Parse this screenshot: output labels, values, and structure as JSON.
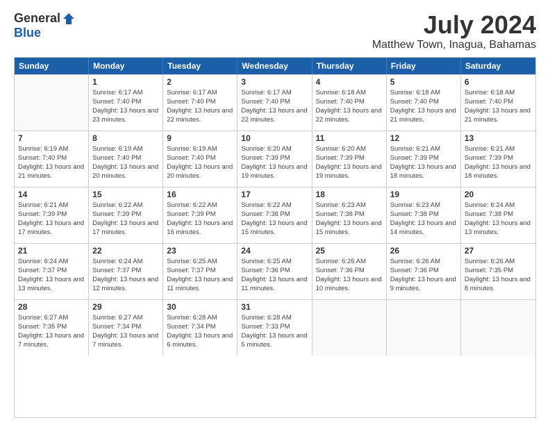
{
  "logo": {
    "general": "General",
    "blue": "Blue"
  },
  "title": {
    "month": "July 2024",
    "location": "Matthew Town, Inagua, Bahamas"
  },
  "calendar": {
    "headers": [
      "Sunday",
      "Monday",
      "Tuesday",
      "Wednesday",
      "Thursday",
      "Friday",
      "Saturday"
    ],
    "rows": [
      [
        {
          "day": "",
          "empty": true
        },
        {
          "day": "1",
          "sunrise": "6:17 AM",
          "sunset": "7:40 PM",
          "daylight": "13 hours and 23 minutes."
        },
        {
          "day": "2",
          "sunrise": "6:17 AM",
          "sunset": "7:40 PM",
          "daylight": "13 hours and 22 minutes."
        },
        {
          "day": "3",
          "sunrise": "6:17 AM",
          "sunset": "7:40 PM",
          "daylight": "13 hours and 22 minutes."
        },
        {
          "day": "4",
          "sunrise": "6:18 AM",
          "sunset": "7:40 PM",
          "daylight": "13 hours and 22 minutes."
        },
        {
          "day": "5",
          "sunrise": "6:18 AM",
          "sunset": "7:40 PM",
          "daylight": "13 hours and 21 minutes."
        },
        {
          "day": "6",
          "sunrise": "6:18 AM",
          "sunset": "7:40 PM",
          "daylight": "13 hours and 21 minutes."
        }
      ],
      [
        {
          "day": "7",
          "sunrise": "6:19 AM",
          "sunset": "7:40 PM",
          "daylight": "13 hours and 21 minutes."
        },
        {
          "day": "8",
          "sunrise": "6:19 AM",
          "sunset": "7:40 PM",
          "daylight": "13 hours and 20 minutes."
        },
        {
          "day": "9",
          "sunrise": "6:19 AM",
          "sunset": "7:40 PM",
          "daylight": "13 hours and 20 minutes."
        },
        {
          "day": "10",
          "sunrise": "6:20 AM",
          "sunset": "7:39 PM",
          "daylight": "13 hours and 19 minutes."
        },
        {
          "day": "11",
          "sunrise": "6:20 AM",
          "sunset": "7:39 PM",
          "daylight": "13 hours and 19 minutes."
        },
        {
          "day": "12",
          "sunrise": "6:21 AM",
          "sunset": "7:39 PM",
          "daylight": "13 hours and 18 minutes."
        },
        {
          "day": "13",
          "sunrise": "6:21 AM",
          "sunset": "7:39 PM",
          "daylight": "13 hours and 18 minutes."
        }
      ],
      [
        {
          "day": "14",
          "sunrise": "6:21 AM",
          "sunset": "7:39 PM",
          "daylight": "13 hours and 17 minutes."
        },
        {
          "day": "15",
          "sunrise": "6:22 AM",
          "sunset": "7:39 PM",
          "daylight": "13 hours and 17 minutes."
        },
        {
          "day": "16",
          "sunrise": "6:22 AM",
          "sunset": "7:39 PM",
          "daylight": "13 hours and 16 minutes."
        },
        {
          "day": "17",
          "sunrise": "6:22 AM",
          "sunset": "7:38 PM",
          "daylight": "13 hours and 15 minutes."
        },
        {
          "day": "18",
          "sunrise": "6:23 AM",
          "sunset": "7:38 PM",
          "daylight": "13 hours and 15 minutes."
        },
        {
          "day": "19",
          "sunrise": "6:23 AM",
          "sunset": "7:38 PM",
          "daylight": "13 hours and 14 minutes."
        },
        {
          "day": "20",
          "sunrise": "6:24 AM",
          "sunset": "7:38 PM",
          "daylight": "13 hours and 13 minutes."
        }
      ],
      [
        {
          "day": "21",
          "sunrise": "6:24 AM",
          "sunset": "7:37 PM",
          "daylight": "13 hours and 13 minutes."
        },
        {
          "day": "22",
          "sunrise": "6:24 AM",
          "sunset": "7:37 PM",
          "daylight": "13 hours and 12 minutes."
        },
        {
          "day": "23",
          "sunrise": "6:25 AM",
          "sunset": "7:37 PM",
          "daylight": "13 hours and 11 minutes."
        },
        {
          "day": "24",
          "sunrise": "6:25 AM",
          "sunset": "7:36 PM",
          "daylight": "13 hours and 11 minutes."
        },
        {
          "day": "25",
          "sunrise": "6:26 AM",
          "sunset": "7:36 PM",
          "daylight": "13 hours and 10 minutes."
        },
        {
          "day": "26",
          "sunrise": "6:26 AM",
          "sunset": "7:36 PM",
          "daylight": "13 hours and 9 minutes."
        },
        {
          "day": "27",
          "sunrise": "6:26 AM",
          "sunset": "7:35 PM",
          "daylight": "13 hours and 8 minutes."
        }
      ],
      [
        {
          "day": "28",
          "sunrise": "6:27 AM",
          "sunset": "7:35 PM",
          "daylight": "13 hours and 7 minutes."
        },
        {
          "day": "29",
          "sunrise": "6:27 AM",
          "sunset": "7:34 PM",
          "daylight": "13 hours and 7 minutes."
        },
        {
          "day": "30",
          "sunrise": "6:28 AM",
          "sunset": "7:34 PM",
          "daylight": "13 hours and 6 minutes."
        },
        {
          "day": "31",
          "sunrise": "6:28 AM",
          "sunset": "7:33 PM",
          "daylight": "13 hours and 5 minutes."
        },
        {
          "day": "",
          "empty": true
        },
        {
          "day": "",
          "empty": true
        },
        {
          "day": "",
          "empty": true
        }
      ]
    ]
  }
}
